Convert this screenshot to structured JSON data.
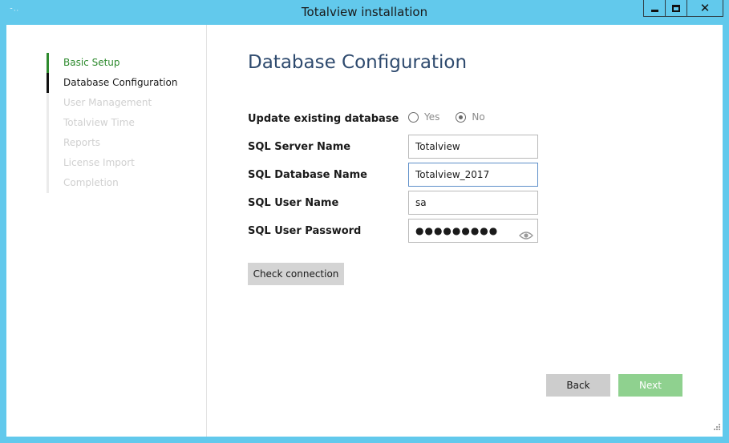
{
  "window": {
    "title": "Totalview installation",
    "app_icon": "˜··",
    "minimize_icon": "minimize-icon",
    "maximize_icon": "maximize-icon",
    "close_glyph": "✕"
  },
  "sidebar": {
    "steps": [
      {
        "label": "Basic Setup",
        "state": "done"
      },
      {
        "label": "Database Configuration",
        "state": "active"
      },
      {
        "label": "User Management",
        "state": "pending"
      },
      {
        "label": "Totalview Time",
        "state": "pending"
      },
      {
        "label": "Reports",
        "state": "pending"
      },
      {
        "label": "License Import",
        "state": "pending"
      },
      {
        "label": "Completion",
        "state": "pending"
      }
    ]
  },
  "main": {
    "title": "Database Configuration",
    "update_db": {
      "label": "Update existing database",
      "options": [
        "Yes",
        "No"
      ],
      "selected": "No"
    },
    "fields": {
      "server_name": {
        "label": "SQL Server Name",
        "value": "Totalview"
      },
      "database_name": {
        "label": "SQL Database Name",
        "value": "Totalview_2017"
      },
      "user_name": {
        "label": "SQL User Name",
        "value": "sa"
      },
      "password": {
        "label": "SQL User Password",
        "value": "●●●●●●●●●"
      }
    },
    "check_connection_label": "Check connection"
  },
  "footer": {
    "back_label": "Back",
    "next_label": "Next"
  },
  "colors": {
    "titlebar": "#62c9ec",
    "step_done": "#2d8a2d",
    "title_text": "#2e4a6e",
    "next_button": "#8fd18f"
  }
}
